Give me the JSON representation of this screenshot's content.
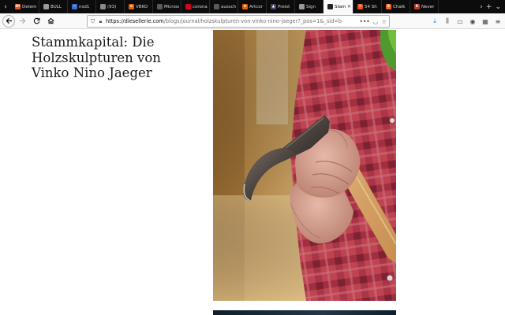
{
  "browser": {
    "tabs": [
      {
        "label": "Detem",
        "favicon": "tab-favicon-letters",
        "favicon_text": "Dt",
        "color": "#e2571e",
        "active": false
      },
      {
        "label": "BULL",
        "favicon": "document-icon",
        "favicon_text": "",
        "color": "#9a9a9a",
        "active": false
      },
      {
        "label": "nsd1",
        "favicon": "wave-icon",
        "favicon_text": "~",
        "color": "#3f6bd8",
        "active": false
      },
      {
        "label": "(93)",
        "favicon": "image-icon",
        "favicon_text": "",
        "color": "#8a8a8a",
        "active": false
      },
      {
        "label": "VBKÖ",
        "favicon": "e-icon",
        "favicon_text": "e",
        "color": "#e66000",
        "active": false
      },
      {
        "label": "Microsof",
        "favicon": "blank-icon",
        "favicon_text": "",
        "color": "#5a5a5a",
        "active": false
      },
      {
        "label": "corona",
        "favicon": "red-circle-icon",
        "favicon_text": "",
        "color": "#d70022",
        "active": false
      },
      {
        "label": "ausschreib",
        "favicon": "blank-icon",
        "favicon_text": "",
        "color": "#5a5a5a",
        "active": false
      },
      {
        "label": "Artcor",
        "favicon": "e-icon",
        "favicon_text": "e",
        "color": "#e66000",
        "active": false
      },
      {
        "label": "Preist",
        "favicon": "triangle-icon",
        "favicon_text": "▲",
        "color": "#444466",
        "active": false
      },
      {
        "label": "Sign",
        "favicon": "circle-icon",
        "favicon_text": "",
        "color": "#999999",
        "active": false
      },
      {
        "label": "Stamm",
        "favicon": "dark-square-icon",
        "favicon_text": "",
        "color": "#222222",
        "active": true
      },
      {
        "label": "54 Sh",
        "favicon": "x-square-icon",
        "favicon_text": "✕",
        "color": "#e2571e",
        "active": false
      },
      {
        "label": "Chalk",
        "favicon": "e-square-icon",
        "favicon_text": "E",
        "color": "#f1641e",
        "active": false
      },
      {
        "label": "Never",
        "favicon": "n-circle-icon",
        "favicon_text": "K",
        "color": "#c23b22",
        "active": false
      }
    ],
    "url": {
      "domain": "https://diesellerie.com",
      "path": "/blogs/journal/holzskulpturen-von-vinko-nino-jaeger?_pos=1&_sid=b"
    },
    "colors": {
      "tabstrip_bg": "#0c0c0d",
      "toolbar_bg": "#f9f9fa",
      "accent": "#0a84ff"
    }
  },
  "article": {
    "title": "Stammkapital: Die Holzskulpturen von Vinko Nino Jaeger"
  }
}
